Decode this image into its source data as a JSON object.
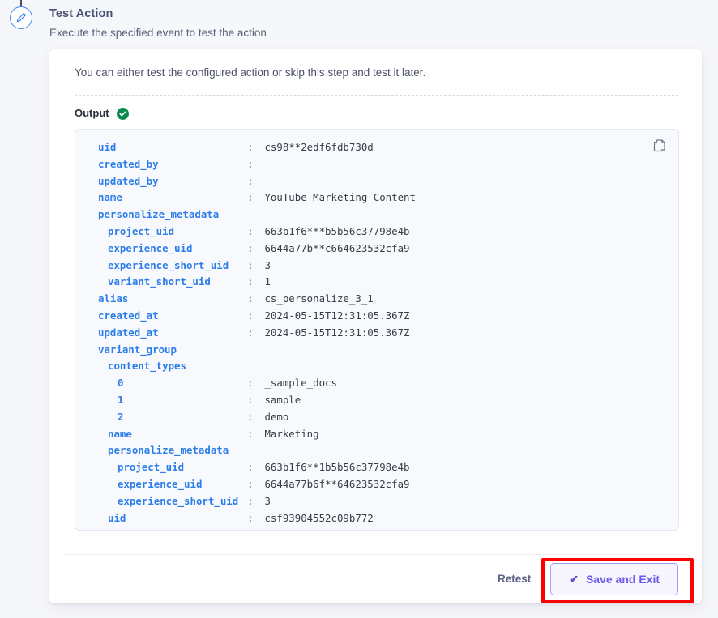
{
  "step": {
    "icon": "pencil-edit-icon",
    "accent_color": "#4285f4"
  },
  "header": {
    "title": "Test Action",
    "subtitle": "Execute the specified event to test the action"
  },
  "card": {
    "intro": "You can either test the configured action or skip this step and test it later.",
    "output_label": "Output",
    "output_status_icon": "check-circle-icon",
    "output_status_color": "#0b8a50",
    "copy_icon": "copy-icon"
  },
  "output_lines": [
    {
      "indent": 0,
      "key": "uid",
      "value": "cs98**2edf6fdb730d",
      "has_value": true
    },
    {
      "indent": 0,
      "key": "created_by",
      "value": "",
      "has_value": true
    },
    {
      "indent": 0,
      "key": "updated_by",
      "value": "",
      "has_value": true
    },
    {
      "indent": 0,
      "key": "name",
      "value": "YouTube Marketing Content",
      "has_value": true
    },
    {
      "indent": 0,
      "key": "personalize_metadata",
      "value": "",
      "has_value": false
    },
    {
      "indent": 1,
      "key": "project_uid",
      "value": "663b1f6***b5b56c37798e4b",
      "has_value": true
    },
    {
      "indent": 1,
      "key": "experience_uid",
      "value": "6644a77b**c664623532cfa9",
      "has_value": true
    },
    {
      "indent": 1,
      "key": "experience_short_uid",
      "value": "3",
      "has_value": true
    },
    {
      "indent": 1,
      "key": "variant_short_uid",
      "value": "1",
      "has_value": true
    },
    {
      "indent": 0,
      "key": "alias",
      "value": "cs_personalize_3_1",
      "has_value": true
    },
    {
      "indent": 0,
      "key": "created_at",
      "value": "2024-05-15T12:31:05.367Z",
      "has_value": true
    },
    {
      "indent": 0,
      "key": "updated_at",
      "value": "2024-05-15T12:31:05.367Z",
      "has_value": true
    },
    {
      "indent": 0,
      "key": "variant_group",
      "value": "",
      "has_value": false
    },
    {
      "indent": 1,
      "key": "content_types",
      "value": "",
      "has_value": false
    },
    {
      "indent": 2,
      "key": "0",
      "value": "_sample_docs",
      "has_value": true
    },
    {
      "indent": 2,
      "key": "1",
      "value": "sample",
      "has_value": true
    },
    {
      "indent": 2,
      "key": "2",
      "value": "demo",
      "has_value": true
    },
    {
      "indent": 1,
      "key": "name",
      "value": "Marketing",
      "has_value": true
    },
    {
      "indent": 1,
      "key": "personalize_metadata",
      "value": "",
      "has_value": false
    },
    {
      "indent": 2,
      "key": "project_uid",
      "value": "663b1f6**1b5b56c37798e4b",
      "has_value": true
    },
    {
      "indent": 2,
      "key": "experience_uid",
      "value": "6644a77b6f**64623532cfa9",
      "has_value": true
    },
    {
      "indent": 2,
      "key": "experience_short_uid",
      "value": "3",
      "has_value": true
    },
    {
      "indent": 1,
      "key": "uid",
      "value": "csf93904552c09b772",
      "has_value": true
    }
  ],
  "footer": {
    "retest_label": "Retest",
    "save_label": "Save and Exit",
    "save_check_glyph": "✔",
    "save_accent_color": "#6c5ce7"
  },
  "annotation": {
    "highlight_color": "#fe0000",
    "target": "save-and-exit-button"
  }
}
